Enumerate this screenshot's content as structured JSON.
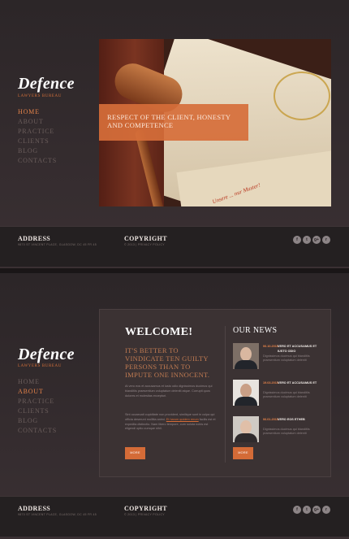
{
  "brand": {
    "name": "Defence",
    "tagline": "LAWYERS BUREAU"
  },
  "nav_items": [
    "HOME",
    "ABOUT",
    "PRACTICE",
    "CLIENTS",
    "BLOG",
    "CONTACTS"
  ],
  "screen1": {
    "active_nav": "HOME",
    "hero_caption": "RESPECT OF THE CLIENT, HONESTY AND COMPETENCE",
    "hero_stamp": "Unsere ... nur Muster!"
  },
  "screen2": {
    "active_nav": "ABOUT",
    "welcome_title": "WELCOME!",
    "quote": "IT'S BETTER TO VINDICATE TEN GUILTY PERSONS THAN TO IMPUTE ONE INNOCENT.",
    "para1": "At vero eos et accusamus et iusto odio dignissimos ducimus qui blanditiis praesentium voluptatum deleniti atque. Corrupti quos dolores et molestias excepturi.",
    "para2_before_link": "Sint occaecati cupiditate non provident, similique sunt in culpa qui officia deserunt mollitia animi. ",
    "para2_link": "Et harum quidem rerum",
    "para2_after_link": " facilis est et expedita distinctio. Nam libero tempore, cum soluta nobis est eligendi optio cumque nihil.",
    "more_button": "MORE",
    "news_title": "OUR NEWS",
    "news": [
      {
        "date": "06.10.2015",
        "headline": "VERO ET ACCUSAMUS ET IUSTO ODIO",
        "body": "Dignissimos ducimus qui blanditiis praesentium voluptatum deleniti"
      },
      {
        "date": "19.03.2015",
        "headline": "VERO ET ACCUSAMUS ET",
        "body": "Dignissimos ducimus qui blanditiis praesentium voluptatum deleniti"
      },
      {
        "date": "06.01.2015",
        "headline": "VERO EOS ETHEB",
        "body": "Dignissimos ducimus qui blanditiis praesentium voluptatum deleniti"
      }
    ],
    "news_more_button": "MORE"
  },
  "footer": {
    "address_title": "ADDRESS",
    "address_text": "9870 ST VINCENT PLACE, GLASGOW, DC 45 FR 45",
    "copyright_title": "COPYRIGHT",
    "copyright_text": "© 2013 | PRIVACY POLICY",
    "social_icons": [
      "facebook-icon",
      "twitter-icon",
      "google-plus-icon",
      "rss-icon"
    ],
    "social_glyphs": [
      "f",
      "t",
      "g+",
      "r"
    ]
  },
  "colors": {
    "accent": "#d46b37",
    "background": "#2c2628",
    "footer": "#242021"
  }
}
